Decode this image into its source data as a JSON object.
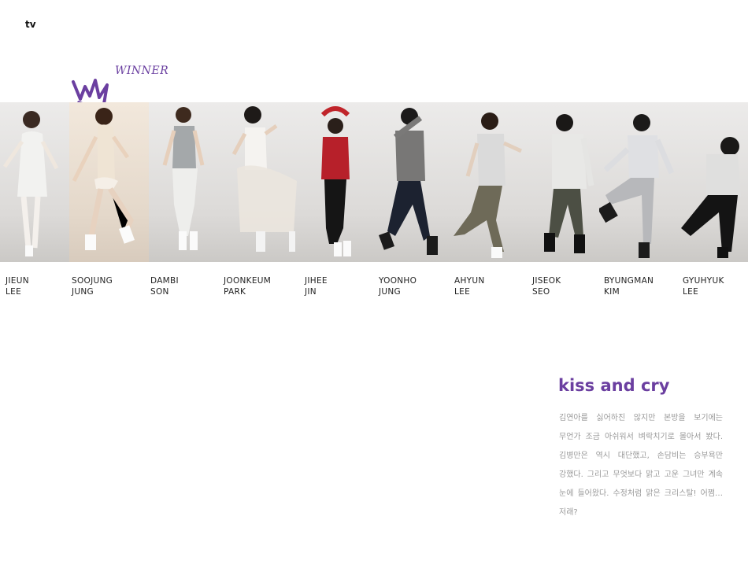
{
  "header": {
    "tv_label": "tv"
  },
  "winner": {
    "label": "WINNER",
    "icon": "crown-icon",
    "color": "#6b3fa0"
  },
  "skaters": [
    {
      "first": "JIEUN",
      "last": "LEE"
    },
    {
      "first": "SOOJUNG",
      "last": "JUNG"
    },
    {
      "first": "DAMBI",
      "last": "SON"
    },
    {
      "first": "JOONKEUM",
      "last": "PARK"
    },
    {
      "first": "JIHEE",
      "last": "JIN"
    },
    {
      "first": "YOONHO",
      "last": "JUNG"
    },
    {
      "first": "AHYUN",
      "last": "LEE"
    },
    {
      "first": "JISEOK",
      "last": "SEO"
    },
    {
      "first": "BYUNGMAN",
      "last": "KIM"
    },
    {
      "first": "GYUHYUK",
      "last": "LEE"
    }
  ],
  "article": {
    "title": "kiss and cry",
    "lines": [
      "김연아를 싫어하진 않지만 본방을 보기에는",
      "무언가 조금 아쉬워서 벼락치기로 몰아서 봤다.",
      "김병만은 역시 대단했고, 손담비는 승부욕만",
      "강했다. 그리고 무엇보다 맑고 고운 그녀만 계속",
      "눈에 들어왔다. 수정처럼 맑은 크리스탈! 어쩜…",
      "저래?"
    ]
  }
}
